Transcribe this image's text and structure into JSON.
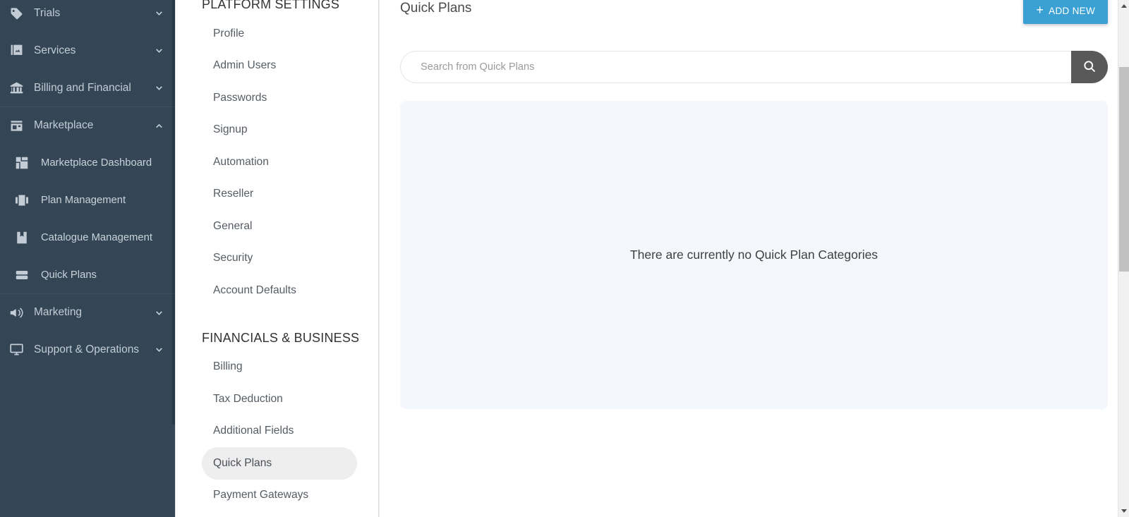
{
  "sidebar": {
    "items": [
      {
        "label": "Trials",
        "icon": "tag-icon",
        "chevron": "chevron-down-icon",
        "type": "group"
      },
      {
        "label": "Services",
        "icon": "services-icon",
        "chevron": "chevron-down-icon",
        "type": "group"
      },
      {
        "label": "Billing and Financial",
        "icon": "bank-icon",
        "chevron": "chevron-down-icon",
        "type": "group"
      },
      {
        "label": "Marketplace",
        "icon": "store-icon",
        "chevron": "chevron-up-icon",
        "type": "group-expanded"
      },
      {
        "label": "Marketplace Dashboard",
        "icon": "dashboard-grid-icon",
        "type": "sub"
      },
      {
        "label": "Plan Management",
        "icon": "plan-columns-icon",
        "type": "sub"
      },
      {
        "label": "Catalogue Management",
        "icon": "catalogue-book-icon",
        "type": "sub"
      },
      {
        "label": "Quick Plans",
        "icon": "quick-plans-stack-icon",
        "type": "sub"
      },
      {
        "label": "Marketing",
        "icon": "megaphone-icon",
        "chevron": "chevron-down-icon",
        "type": "group"
      },
      {
        "label": "Support & Operations",
        "icon": "monitor-icon",
        "chevron": "chevron-down-icon",
        "type": "group"
      }
    ]
  },
  "navpanel": {
    "sections": [
      {
        "heading": "PLATFORM SETTINGS",
        "items": [
          {
            "label": "Profile",
            "active": false
          },
          {
            "label": "Admin Users",
            "active": false
          },
          {
            "label": "Passwords",
            "active": false
          },
          {
            "label": "Signup",
            "active": false
          },
          {
            "label": "Automation",
            "active": false
          },
          {
            "label": "Reseller",
            "active": false
          },
          {
            "label": "General",
            "active": false
          },
          {
            "label": "Security",
            "active": false
          },
          {
            "label": "Account Defaults",
            "active": false
          }
        ]
      },
      {
        "heading": "FINANCIALS & BUSINESS",
        "items": [
          {
            "label": "Billing",
            "active": false
          },
          {
            "label": "Tax Deduction",
            "active": false
          },
          {
            "label": "Additional Fields",
            "active": false
          },
          {
            "label": "Quick Plans",
            "active": true
          },
          {
            "label": "Payment Gateways",
            "active": false
          }
        ]
      }
    ]
  },
  "main": {
    "title": "Quick Plans",
    "add_new_label": "ADD NEW",
    "add_new_icon": "plus-icon",
    "search_placeholder": "Search from Quick Plans",
    "search_value": "",
    "search_icon": "search-icon",
    "empty_message": "There are currently no Quick Plan Categories"
  },
  "colors": {
    "sidebar_bg": "#344656",
    "accent_blue": "#3ba1d4",
    "search_button": "#595959",
    "empty_panel_bg": "#f4f8fc",
    "active_pill": "#eeeeee"
  }
}
